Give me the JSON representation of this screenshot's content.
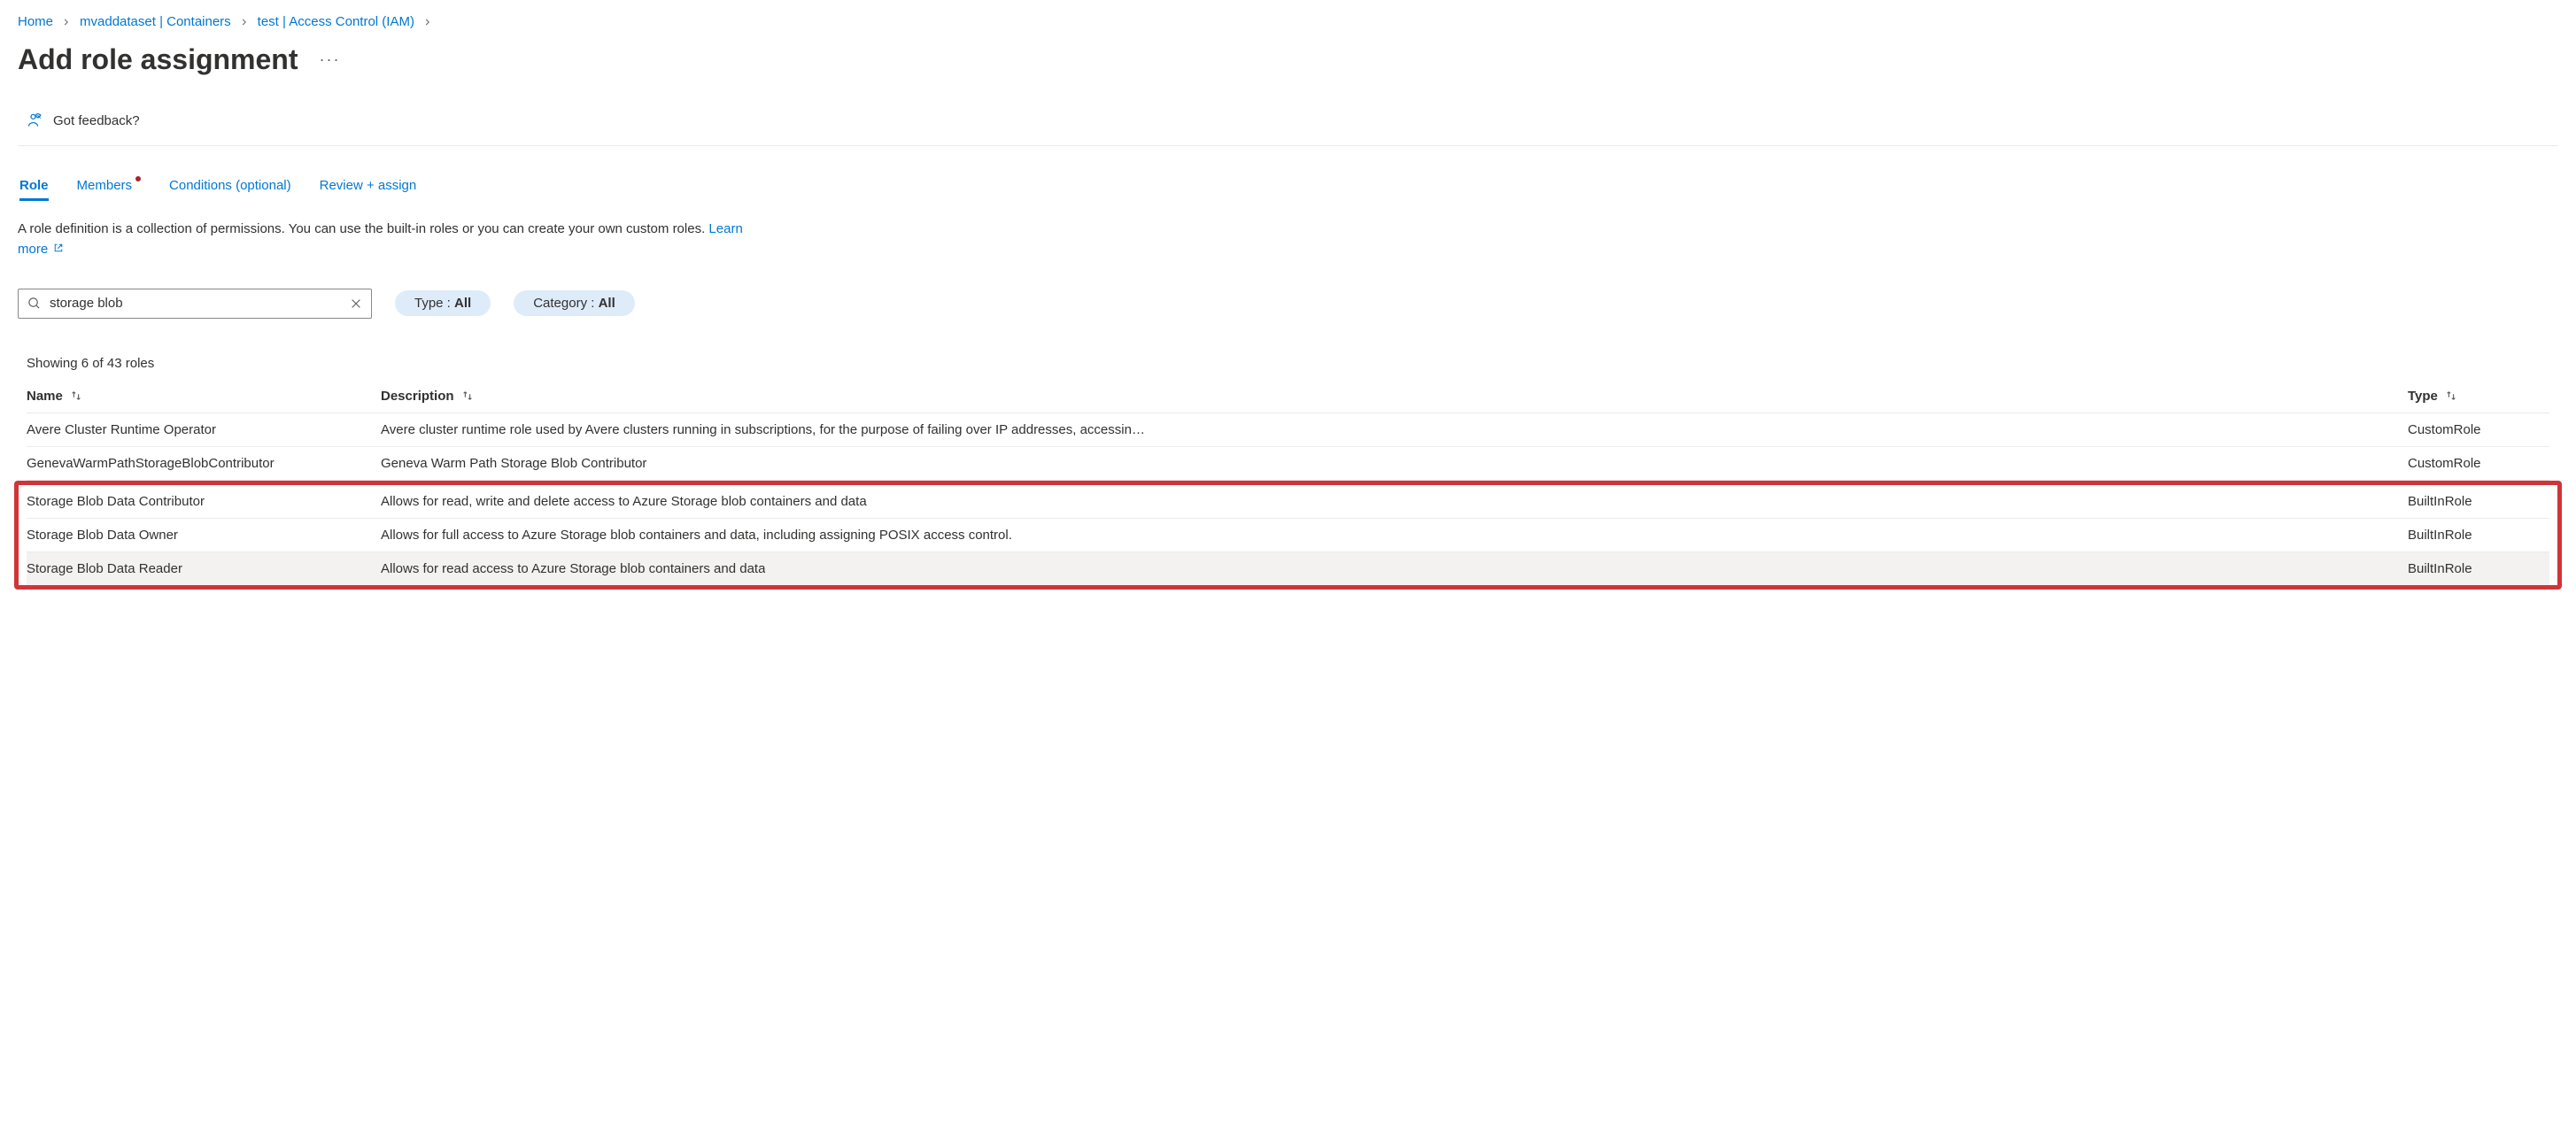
{
  "breadcrumb": {
    "items": [
      "Home",
      "mvaddataset | Containers",
      "test | Access Control (IAM)"
    ]
  },
  "pageTitle": "Add role assignment",
  "feedbackLabel": "Got feedback?",
  "tabs": [
    {
      "label": "Role",
      "active": true,
      "dot": false
    },
    {
      "label": "Members",
      "active": false,
      "dot": true
    },
    {
      "label": "Conditions (optional)",
      "active": false,
      "dot": false
    },
    {
      "label": "Review + assign",
      "active": false,
      "dot": false
    }
  ],
  "helper": {
    "text1": "A role definition is a collection of permissions. You can use the built-in roles or you can create your own custom roles. ",
    "learnMore": "Learn more"
  },
  "filters": {
    "searchValue": "storage blob",
    "typeLabel": "Type : ",
    "typeValue": "All",
    "categoryLabel": "Category : ",
    "categoryValue": "All"
  },
  "countLabel": "Showing 6 of 43 roles",
  "columns": {
    "name": "Name",
    "description": "Description",
    "type": "Type"
  },
  "rows": [
    {
      "name": "Avere Cluster Runtime Operator",
      "description": "Avere cluster runtime role used by Avere clusters running in subscriptions, for the purpose of failing over IP addresses, accessin…",
      "type": "CustomRole",
      "highlight": false,
      "hovered": false
    },
    {
      "name": "GenevaWarmPathStorageBlobContributor",
      "description": "Geneva Warm Path Storage Blob Contributor",
      "type": "CustomRole",
      "highlight": false,
      "hovered": false
    },
    {
      "name": "Storage Blob Data Contributor",
      "description": "Allows for read, write and delete access to Azure Storage blob containers and data",
      "type": "BuiltInRole",
      "highlight": true,
      "hovered": false
    },
    {
      "name": "Storage Blob Data Owner",
      "description": "Allows for full access to Azure Storage blob containers and data, including assigning POSIX access control.",
      "type": "BuiltInRole",
      "highlight": true,
      "hovered": false
    },
    {
      "name": "Storage Blob Data Reader",
      "description": "Allows for read access to Azure Storage blob containers and data",
      "type": "BuiltInRole",
      "highlight": true,
      "hovered": true
    }
  ]
}
